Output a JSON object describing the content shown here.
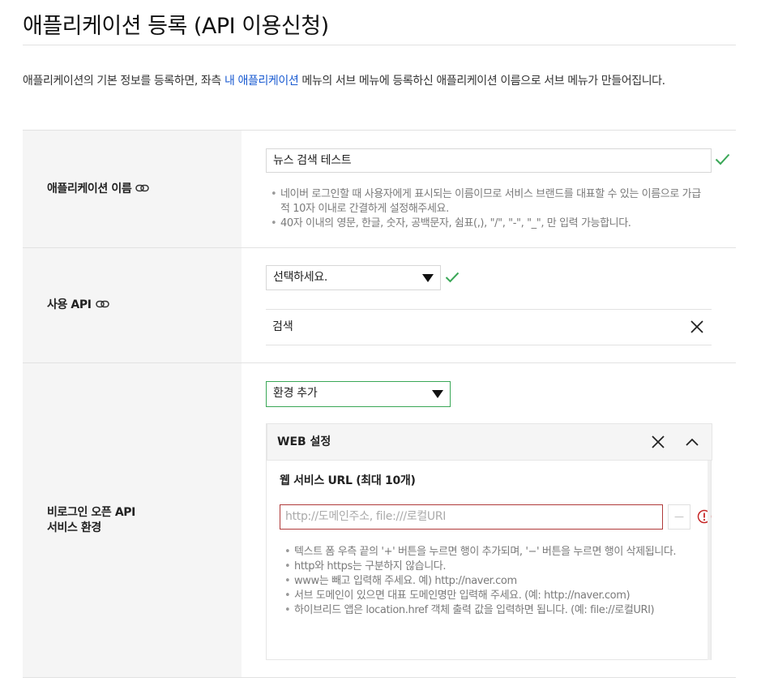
{
  "page": {
    "title": "애플리케이션 등록 (API 이용신청)"
  },
  "intro": {
    "text_before": "애플리케이션의 기본 정보를 등록하면, 좌측 ",
    "link": "내 애플리케이션",
    "text_after": " 메뉴의 서브 메뉴에 등록하신 애플리케이션 이름으로 서브 메뉴가 만들어집니다."
  },
  "app_name": {
    "label": "애플리케이션 이름",
    "value": "뉴스 검색 테스트",
    "notes": [
      "네이버 로그인할 때 사용자에게 표시되는 이름이므로 서비스 브랜드를 대표할 수 있는 이름으로 가급적 10자 이내로 간결하게 설정해주세요.",
      "40자 이내의 영문, 한글, 숫자, 공백문자, 쉼표(,), \"/\", \"-\", \"_\", 만 입력 가능합니다."
    ]
  },
  "api": {
    "label": "사용 API",
    "select_value": "선택하세요.",
    "selected_item": "검색"
  },
  "env": {
    "label_line1": "비로그인 오픈 API",
    "label_line2": "서비스 환경",
    "select_value": "환경 추가",
    "web_header": "WEB 설정",
    "url_label": "웹 서비스 URL (최대 10개)",
    "url_placeholder": "http://도메인주소, file:///로컬URI",
    "minus_label": "—",
    "notes": [
      "텍스트 폼 우측 끝의 '+' 버튼을 누르면 행이 추가되며, '−' 버튼을 누르면 행이 삭제됩니다.",
      "http와 https는 구분하지 않습니다.",
      "www는 빼고 입력해 주세요. 예) http://naver.com",
      "서브 도메인이 있으면 대표 도메인명만 입력해 주세요. (예: http://naver.com)",
      "하이브리드 앱은 location.href 객체 출력 값을 입력하면 됩니다. (예: file://로컬URI)"
    ]
  },
  "colors": {
    "link": "#1a5bd1",
    "check": "#3aa757",
    "error": "#c62828",
    "label_bg": "#f5f5f5"
  }
}
